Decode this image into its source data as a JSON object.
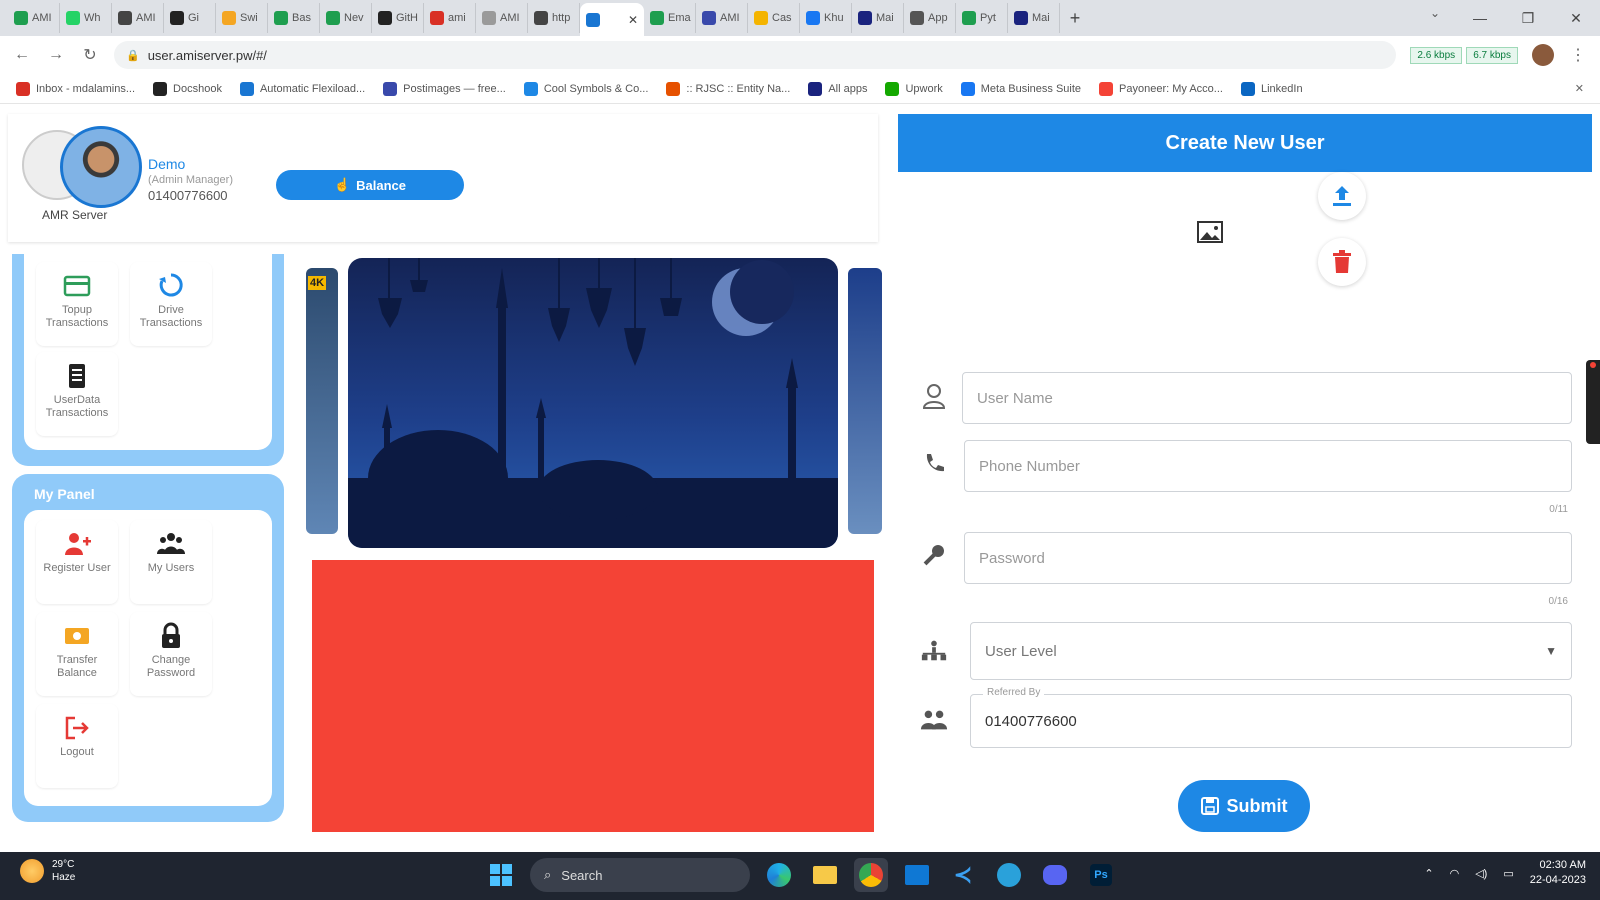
{
  "browser": {
    "tabs": [
      {
        "title": "AMI",
        "color": "#1e9e4f"
      },
      {
        "title": "Wh",
        "color": "#25d366"
      },
      {
        "title": "AMI",
        "color": "#444"
      },
      {
        "title": "Gi",
        "color": "#222"
      },
      {
        "title": "Swi",
        "color": "#f4a623"
      },
      {
        "title": "Bas",
        "color": "#1e9e4f"
      },
      {
        "title": "Nev",
        "color": "#1e9e4f"
      },
      {
        "title": "GitH",
        "color": "#222"
      },
      {
        "title": "ami",
        "color": "#d93025"
      },
      {
        "title": "AMI",
        "color": "#9a9a9a"
      },
      {
        "title": "http",
        "color": "#444"
      },
      {
        "title": "",
        "color": "#1976d2",
        "active": true
      },
      {
        "title": "Ema",
        "color": "#1e9e4f"
      },
      {
        "title": "AMI",
        "color": "#3949ab"
      },
      {
        "title": "Cas",
        "color": "#f4b400"
      },
      {
        "title": "Khu",
        "color": "#1877f2"
      },
      {
        "title": "Mai",
        "color": "#1a237e"
      },
      {
        "title": "App",
        "color": "#555"
      },
      {
        "title": "Pyt",
        "color": "#1e9e4f"
      },
      {
        "title": "Mai",
        "color": "#1a237e"
      }
    ],
    "url": "user.amiserver.pw/#/",
    "speed_up": "2.6 kbps",
    "speed_down": "6.7 kbps",
    "bookmarks": [
      {
        "label": "Inbox - mdalamins...",
        "color": "#d93025"
      },
      {
        "label": "Docshook",
        "color": "#222"
      },
      {
        "label": "Automatic Flexiload...",
        "color": "#1976d2"
      },
      {
        "label": "Postimages — free...",
        "color": "#3949ab"
      },
      {
        "label": "Cool Symbols & Co...",
        "color": "#1e88e5"
      },
      {
        "label": ":: RJSC :: Entity Na...",
        "color": "#e65100"
      },
      {
        "label": "All apps",
        "color": "#1a237e"
      },
      {
        "label": "Upwork",
        "color": "#14a800"
      },
      {
        "label": "Meta Business Suite",
        "color": "#1877f2"
      },
      {
        "label": "Payoneer: My Acco...",
        "color": "#f44336"
      },
      {
        "label": "LinkedIn",
        "color": "#0a66c2"
      }
    ]
  },
  "profile": {
    "app_name": "AMR Server",
    "name": "Demo",
    "role": "(Admin Manager)",
    "phone": "01400776600",
    "balance_label": "Balance"
  },
  "panel_top": {
    "tiles": [
      {
        "label": "Topup Transactions",
        "icon": "topup-card-icon",
        "color": "#2e9d5a"
      },
      {
        "label": "Drive Transactions",
        "icon": "drive-sync-icon",
        "color": "#1e88e5"
      },
      {
        "label": "UserData Transactions",
        "icon": "data-doc-icon",
        "color": "#222"
      }
    ]
  },
  "my_panel": {
    "title": "My Panel",
    "tiles": [
      {
        "label": "Register User",
        "icon": "add-user-icon",
        "color": "#e53935"
      },
      {
        "label": "My Users",
        "icon": "users-group-icon",
        "color": "#222"
      },
      {
        "label": "Transfer Balance",
        "icon": "money-transfer-icon",
        "color": "#f4a623"
      },
      {
        "label": "Change Password",
        "icon": "lock-icon",
        "color": "#222"
      },
      {
        "label": "Logout",
        "icon": "logout-icon",
        "color": "#e53935"
      }
    ]
  },
  "carousel": {
    "left_tag": "4K"
  },
  "form": {
    "title": "Create New User",
    "username_placeholder": "User Name",
    "phone_placeholder": "Phone Number",
    "phone_counter": "0/11",
    "password_placeholder": "Password",
    "password_counter": "0/16",
    "level_placeholder": "User Level",
    "referred_label": "Referred By",
    "referred_value": "01400776600",
    "submit_label": "Submit"
  },
  "taskbar": {
    "temp": "29°C",
    "weather": "Haze",
    "search_label": "Search",
    "time": "02:30 AM",
    "date": "22-04-2023"
  }
}
